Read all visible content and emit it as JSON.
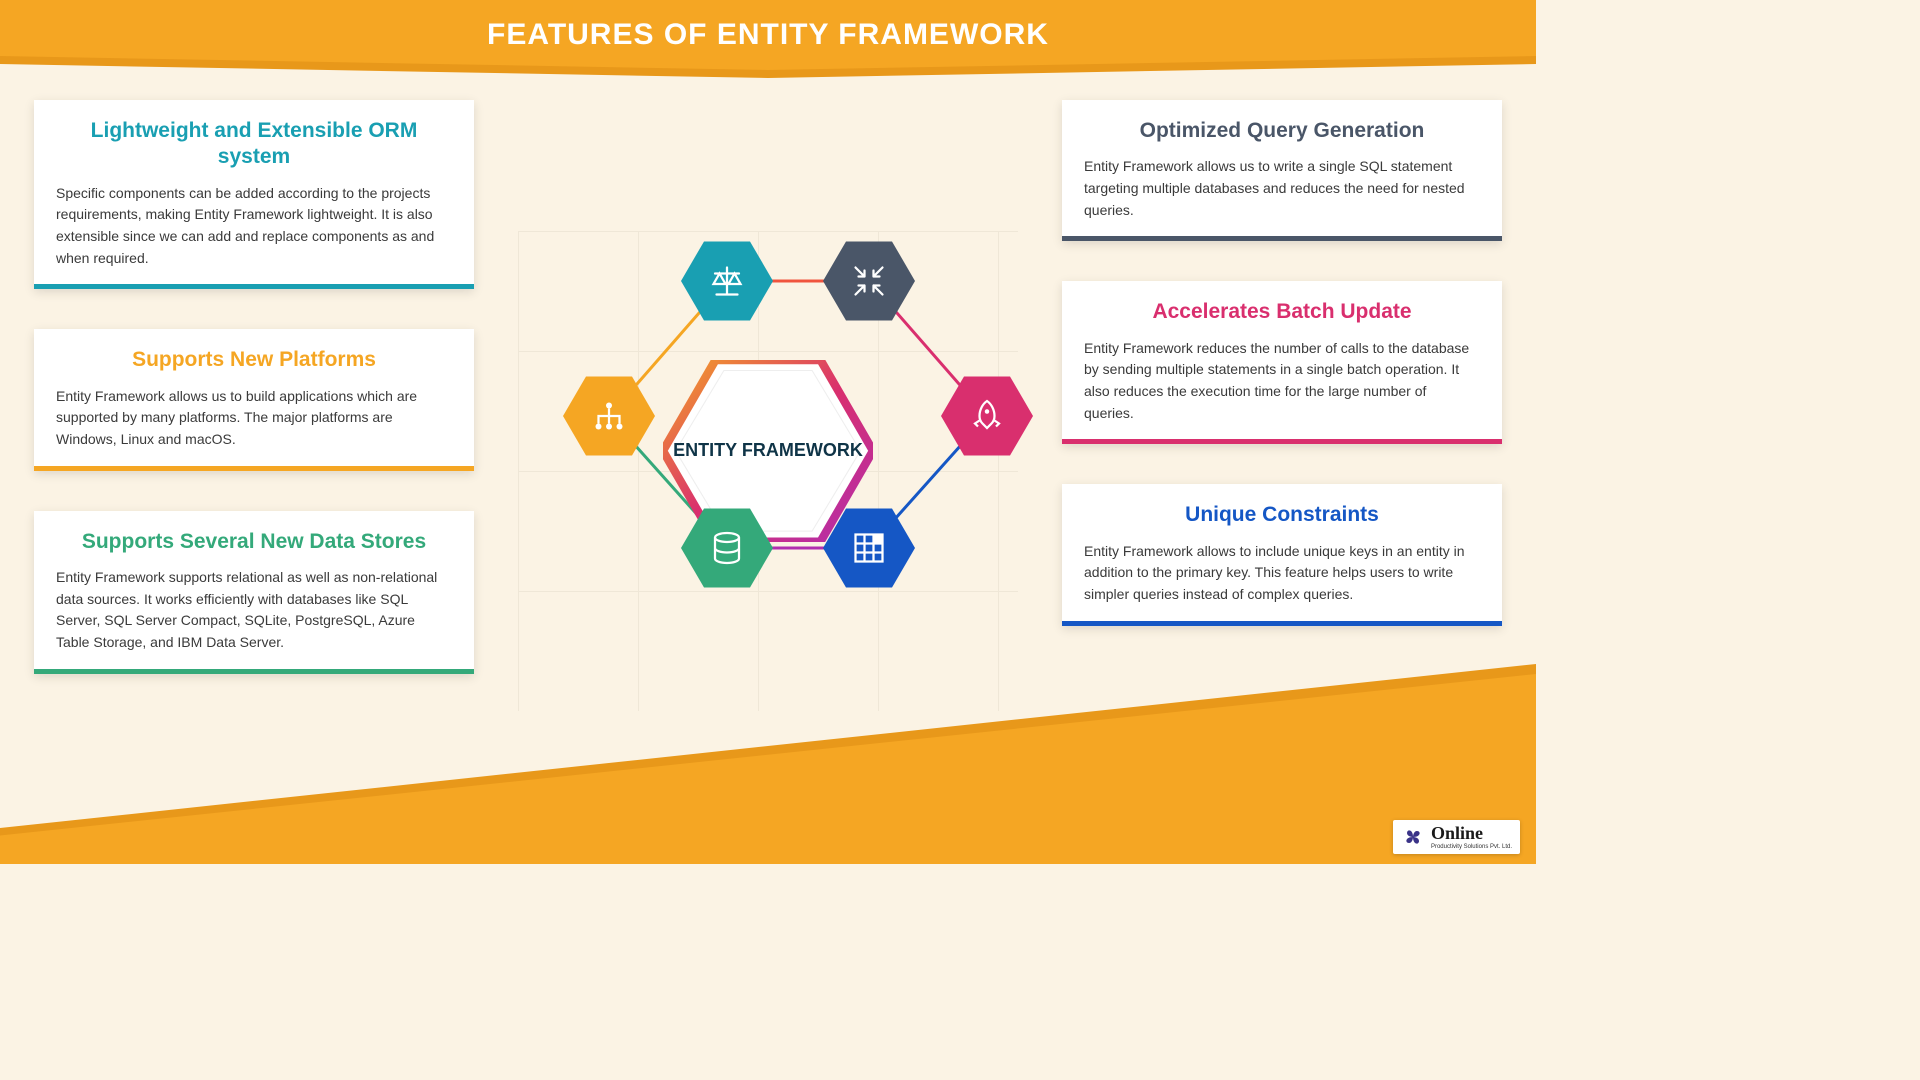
{
  "title": "FEATURES OF ENTITY FRAMEWORK",
  "center_label": "ENTITY FRAMEWORK",
  "logo": {
    "name": "Online",
    "subtitle": "Productivity Solutions Pvt. Ltd."
  },
  "colors": {
    "teal": "#199fb2",
    "slate": "#4a5668",
    "orange": "#f5a623",
    "pink": "#d92f6e",
    "green": "#34a97a",
    "blue": "#1557c5"
  },
  "left_cards": [
    {
      "title": "Lightweight and Extensible ORM system",
      "body": "Specific components can be added according to the projects requirements, making Entity Framework lightweight. It is also extensible since we can add and replace components as and when required.",
      "accent": "teal"
    },
    {
      "title": "Supports New Platforms",
      "body": "Entity Framework allows us to build applications which are supported by many platforms. The major platforms are Windows, Linux and macOS.",
      "accent": "orange"
    },
    {
      "title": "Supports Several New Data Stores",
      "body": "Entity Framework supports relational as well as non-relational data sources. It works efficiently with databases like SQL Server, SQL Server Compact, SQLite, PostgreSQL, Azure Table Storage, and IBM Data Server.",
      "accent": "green"
    }
  ],
  "right_cards": [
    {
      "title": "Optimized Query Generation",
      "body": "Entity Framework allows us to write a single SQL statement targeting multiple databases and reduces the need for nested queries.",
      "accent": "slate"
    },
    {
      "title": "Accelerates Batch Update",
      "body": "Entity Framework reduces the number of calls to the database by sending multiple statements in a single batch operation. It also reduces the execution time for the large number of queries.",
      "accent": "pink"
    },
    {
      "title": "Unique Constraints",
      "body": "Entity Framework allows to include unique keys in an entity in addition to the primary key. This feature helps users to write simpler queries instead of complex queries.",
      "accent": "blue"
    }
  ],
  "nodes": [
    {
      "color": "teal",
      "icon": "scale-icon"
    },
    {
      "color": "slate",
      "icon": "collapse-icon"
    },
    {
      "color": "orange",
      "icon": "hierarchy-icon"
    },
    {
      "color": "pink",
      "icon": "rocket-icon"
    },
    {
      "color": "green",
      "icon": "database-icon"
    },
    {
      "color": "blue",
      "icon": "grid-icon"
    }
  ]
}
